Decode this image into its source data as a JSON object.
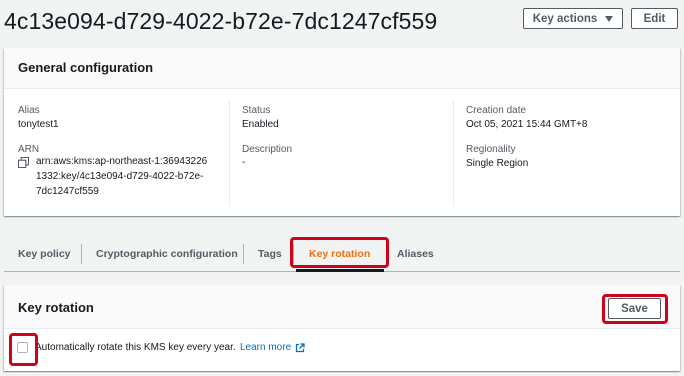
{
  "header": {
    "title": "4c13e094-d729-4022-b72e-7dc1247cf559",
    "key_actions_label": "Key actions",
    "edit_label": "Edit"
  },
  "general": {
    "title": "General configuration",
    "alias_label": "Alias",
    "alias_value": "tonytest1",
    "arn_label": "ARN",
    "arn_line1": "arn:aws:kms:ap-northeast-1:36943226",
    "arn_line2": "1332:key/4c13e094-d729-4022-b72e-",
    "arn_line3": "7dc1247cf559",
    "status_label": "Status",
    "status_value": "Enabled",
    "description_label": "Description",
    "description_value": "-",
    "creation_label": "Creation date",
    "creation_value": "Oct 05, 2021 15:44 GMT+8",
    "regionality_label": "Regionality",
    "regionality_value": "Single Region"
  },
  "tabs": [
    {
      "label": "Key policy"
    },
    {
      "label": "Cryptographic configuration"
    },
    {
      "label": "Tags"
    },
    {
      "label": "Key rotation"
    },
    {
      "label": "Aliases"
    }
  ],
  "rotation": {
    "title": "Key rotation",
    "save_label": "Save",
    "checkbox_label": "Automatically rotate this KMS key every year.",
    "checkbox_checked": false,
    "learn_more": "Learn more"
  },
  "colors": {
    "accent_orange": "#ec7211",
    "link_blue": "#0073bb",
    "highlight_red": "#d0021b"
  }
}
